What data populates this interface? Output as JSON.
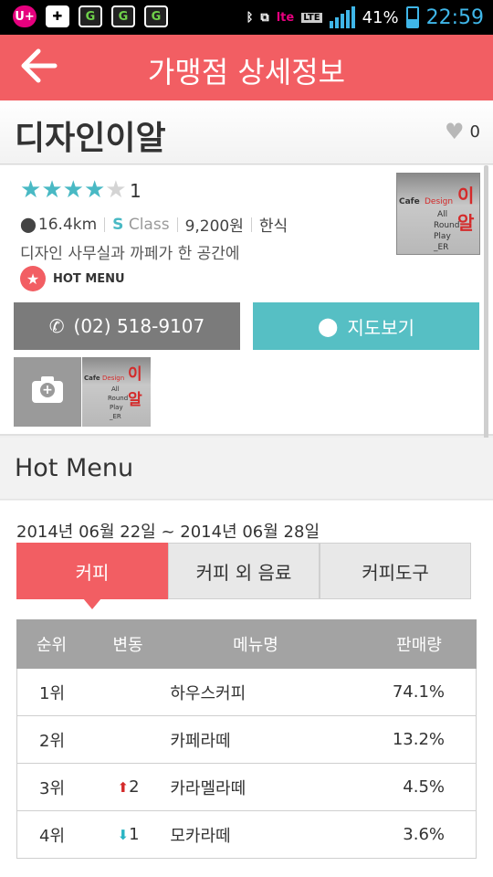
{
  "status_bar": {
    "app_icons": [
      "U+",
      "✚",
      "G",
      "G",
      "G"
    ],
    "network_badge": "LTE",
    "carrier_badge": "lte",
    "battery_percent": "41%",
    "battery_level": 0.41,
    "time": "22:59"
  },
  "header": {
    "title": "가맹점 상세정보",
    "back_icon": "arrow-left-icon"
  },
  "store": {
    "name": "디자인이알",
    "like_count": "0",
    "rating": 4,
    "rating_max": 5,
    "review_count": "1",
    "distance": "16.4km",
    "class_letter": "S",
    "class_word": "Class",
    "price": "9,200원",
    "category": "한식",
    "description": "디자인 사무실과 까페가 한 공간에",
    "hot_menu_badge": "HOT MENU",
    "phone": "(02) 518-9107",
    "map_label": "지도보기",
    "thumbnail_text": {
      "cafe": "Cafe",
      "design": "Design",
      "line1": "All",
      "line2": "Round",
      "line3": "Play",
      "line4": "_ER",
      "red1": "이",
      "red2": "알"
    }
  },
  "hot_menu": {
    "title": "Hot Menu",
    "period": "2014년 06월 22일 ~ 2014년 06월 28일",
    "tabs": [
      {
        "label": "커피",
        "active": true
      },
      {
        "label": "커피 외 음료",
        "active": false
      },
      {
        "label": "커피도구",
        "active": false
      }
    ],
    "columns": [
      "순위",
      "변동",
      "메뉴명",
      "판매량"
    ],
    "rows": [
      {
        "rank": "1위",
        "change_dir": "",
        "change": "",
        "name": "하우스커피",
        "sales": "74.1%"
      },
      {
        "rank": "2위",
        "change_dir": "",
        "change": "",
        "name": "카페라떼",
        "sales": "13.2%"
      },
      {
        "rank": "3위",
        "change_dir": "up",
        "change": "2",
        "name": "카라멜라떼",
        "sales": "4.5%"
      },
      {
        "rank": "4위",
        "change_dir": "down",
        "change": "1",
        "name": "모카라떼",
        "sales": "3.6%"
      }
    ]
  }
}
